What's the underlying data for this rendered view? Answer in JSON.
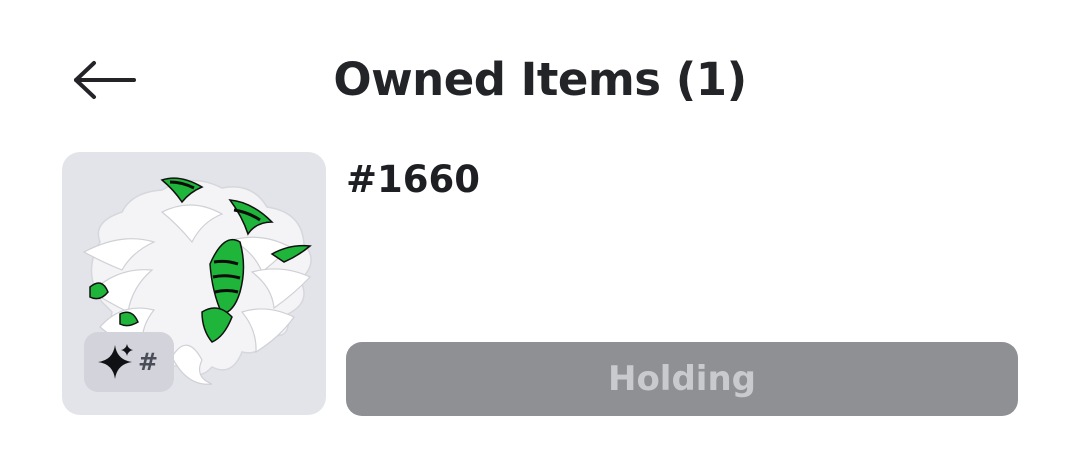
{
  "header": {
    "back_icon": "arrow-left-icon",
    "title": "Owned Items (1)"
  },
  "item": {
    "serial": "#1660",
    "thumbnail_description_icon": "hair-accessory",
    "badge": {
      "icon": "sparkle-icon",
      "hash": "#"
    },
    "button_label": "Holding"
  },
  "colors": {
    "background": "#ffffff",
    "thumbnail_bg": "#e3e4ea",
    "button_bg": "#8f9094",
    "button_text": "#c9cacd",
    "title_text": "#222428",
    "hair_green": "#1fb43a"
  }
}
